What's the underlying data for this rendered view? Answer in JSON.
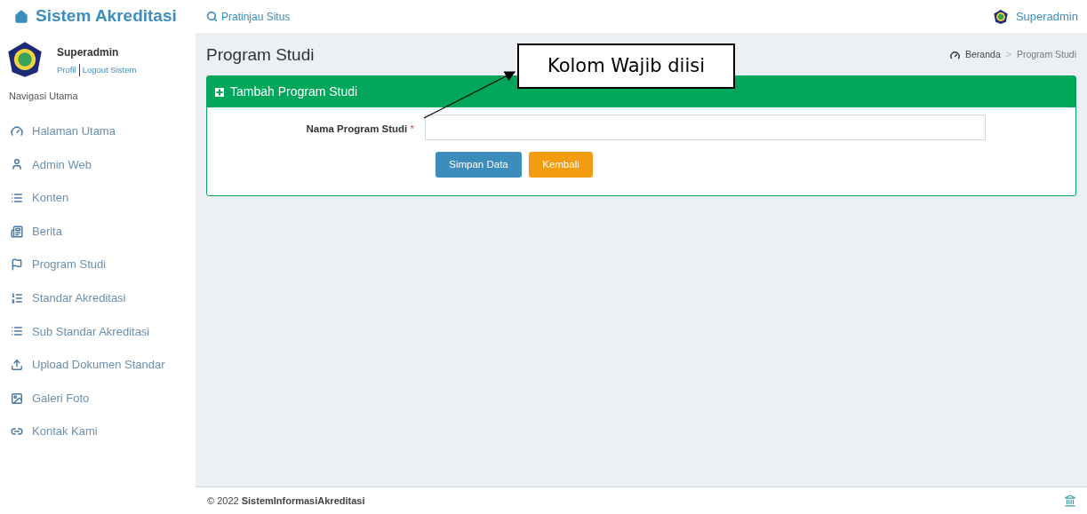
{
  "header": {
    "brand": "Sistem Akreditasi",
    "preview_link": "Pratinjau Situs",
    "user": "Superadmin"
  },
  "sidebar": {
    "user": {
      "name": "Superadmin",
      "links": [
        "Profil",
        "Logout Sistem"
      ]
    },
    "nav_label": "Navigasi Utama",
    "items": [
      {
        "kind": "dashboard",
        "label": "Halaman Utama"
      },
      {
        "kind": "user",
        "label": "Admin Web"
      },
      {
        "kind": "content",
        "label": "Konten"
      },
      {
        "kind": "news",
        "label": "Berita"
      },
      {
        "kind": "flag",
        "label": "Program Studi"
      },
      {
        "kind": "ordered",
        "label": "Standar Akreditasi"
      },
      {
        "kind": "list",
        "label": "Sub Standar Akreditasi"
      },
      {
        "kind": "upload",
        "label": "Upload Dokumen Standar"
      },
      {
        "kind": "image",
        "label": "Galeri Foto"
      },
      {
        "kind": "link",
        "label": "Kontak Kami"
      }
    ]
  },
  "page": {
    "title": "Program Studi",
    "breadcrumb": [
      "Beranda",
      "Program Studi"
    ],
    "breadcrumb_separator": ">"
  },
  "panel": {
    "title": "Tambah Program Studi",
    "field": {
      "label": "Nama Program Studi",
      "required_mark": "*"
    },
    "buttons": [
      {
        "kind": "primary",
        "label": "Simpan Data"
      },
      {
        "kind": "warning",
        "label": "Kembali"
      }
    ]
  },
  "annotation": {
    "text": "Kolom Wajib diisi"
  },
  "footer": {
    "text": "© 2022 **SistemInformasiAkreditasi**"
  }
}
